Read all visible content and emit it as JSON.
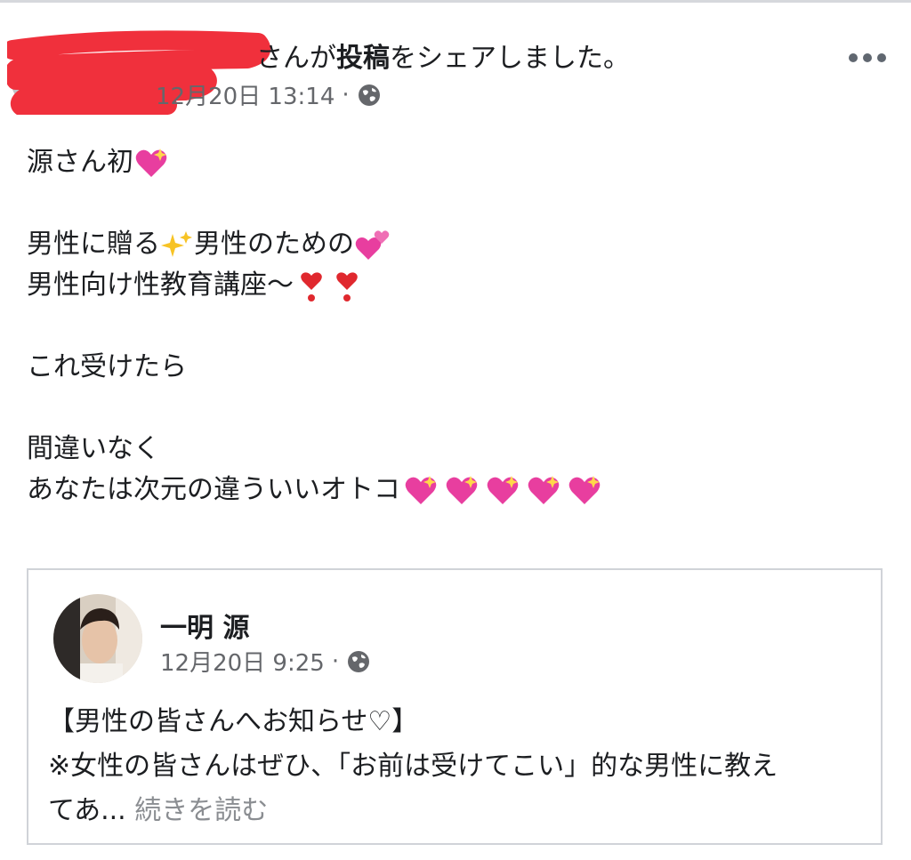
{
  "header": {
    "share_prefix": "さんが",
    "share_bold": "投稿",
    "share_suffix": "をシェアしました。",
    "timestamp": "12月20日 13:14",
    "separator": "·",
    "privacy_icon": "globe-icon",
    "more_icon": "more-options-icon"
  },
  "post": {
    "lines": [
      "源さん初",
      "",
      "男性に贈る",
      "男性向け性教育講座〜",
      "",
      "これ受けたら",
      "",
      "間違いなく",
      "あなたは次元の違ういいオトコ"
    ],
    "line3_middle": "男性のための"
  },
  "shared_card": {
    "author_name": "一明 源",
    "timestamp": "12月20日 9:25",
    "separator": "·",
    "text_line1": "【男性の皆さんへお知らせ♡】",
    "text_line2": "※女性の皆さんはぜひ、「お前は受けてこい」的な男性に教え",
    "text_line3": "てあ...",
    "see_more": "続きを読む"
  },
  "colors": {
    "text": "#1c1e21",
    "secondary": "#65676b",
    "redaction": "#f0303c",
    "border": "#d0d3d8",
    "emoji_pink": "#e83e9f"
  }
}
